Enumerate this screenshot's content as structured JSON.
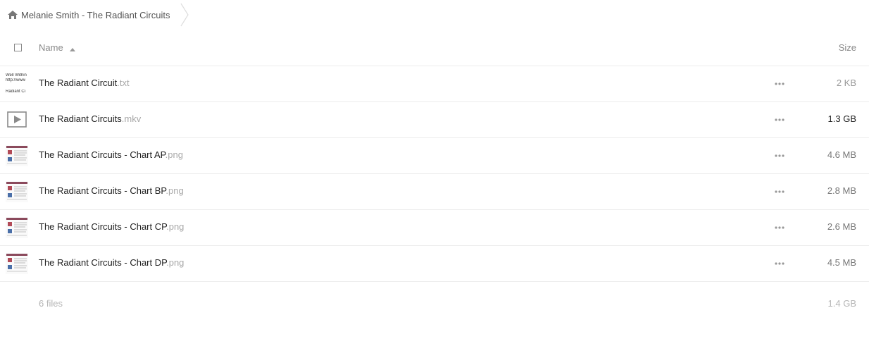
{
  "breadcrumb": {
    "home_icon": "home-icon",
    "label": "Melanie Smith - The Radiant Circuits"
  },
  "header": {
    "name_label": "Name",
    "size_label": "Size",
    "sort_direction": "ascending"
  },
  "files": [
    {
      "base": "The Radiant Circuit",
      "ext": ".txt",
      "size": "2 KB",
      "size_color": "#9a9a9a",
      "thumb": "text",
      "thumb_text": [
        "Well Within",
        "http://www",
        "Radiant Ci"
      ]
    },
    {
      "base": "The Radiant Circuits",
      "ext": ".mkv",
      "size": "1.3 GB",
      "size_color": "#222222",
      "thumb": "video"
    },
    {
      "base": "The Radiant Circuits - Chart AP",
      "ext": ".png",
      "size": "4.6 MB",
      "size_color": "#777777",
      "thumb": "image"
    },
    {
      "base": "The Radiant Circuits - Chart BP",
      "ext": ".png",
      "size": "2.8 MB",
      "size_color": "#777777",
      "thumb": "image"
    },
    {
      "base": "The Radiant Circuits - Chart CP",
      "ext": ".png",
      "size": "2.6 MB",
      "size_color": "#777777",
      "thumb": "image"
    },
    {
      "base": "The Radiant Circuits - Chart DP",
      "ext": ".png",
      "size": "4.5 MB",
      "size_color": "#777777",
      "thumb": "image"
    }
  ],
  "footer": {
    "count": "6 files",
    "total": "1.4 GB"
  }
}
